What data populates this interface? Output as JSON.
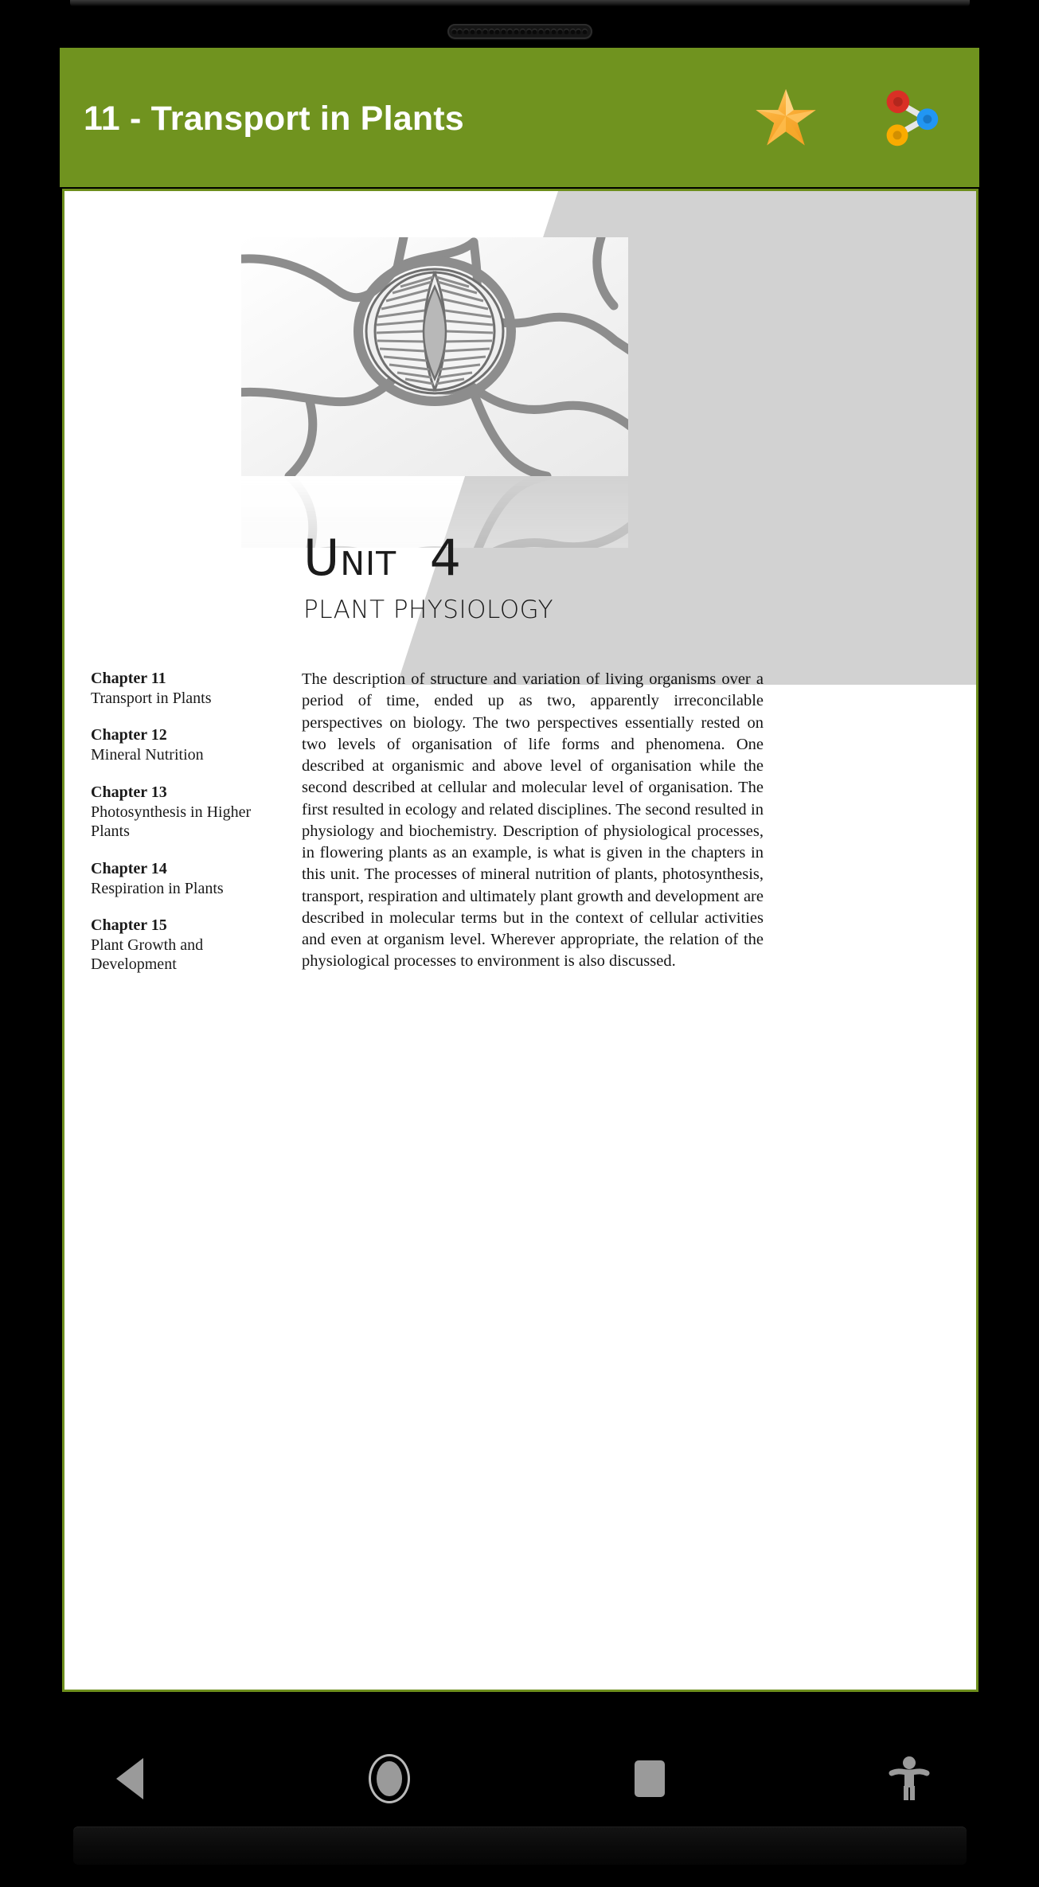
{
  "device": {
    "speaker_grille_holes": 22
  },
  "app": {
    "header": {
      "title": "11 - Transport in Plants",
      "background_color": "#70931f",
      "title_color": "#ffffff",
      "actions": [
        {
          "name": "bookmark-star",
          "icon": "star-icon",
          "colors": [
            "#f5a623",
            "#ffc85c",
            "#e8931a"
          ]
        },
        {
          "name": "share",
          "icon": "share-icon",
          "colors": [
            "#d93025",
            "#2196f3",
            "#f9ab00"
          ]
        }
      ]
    },
    "page": {
      "border_color": "#6e8f1d",
      "background_color": "#ffffff",
      "gray_panel_color": "#d2d2d2",
      "figure": {
        "name": "stomata-diagram",
        "caption": "",
        "description": "Grayscale micrograph-style illustration of a stoma with guard cells surrounded by epidermal cells"
      },
      "unit": {
        "title_lead": "U",
        "title_rest": "NIT",
        "title_number": "4",
        "subtitle": "PLANT PHYSIOLOGY"
      },
      "chapters": [
        {
          "number": "Chapter 11",
          "name": "Transport in Plants"
        },
        {
          "number": "Chapter 12",
          "name": "Mineral Nutrition"
        },
        {
          "number": "Chapter 13",
          "name": "Photosynthesis in Higher Plants"
        },
        {
          "number": "Chapter 14",
          "name": "Respiration in Plants"
        },
        {
          "number": "Chapter 15",
          "name": "Plant Growth and Development"
        }
      ],
      "intro_text": "The description of structure and variation of living organisms over a period of time, ended up as two, apparently irreconcilable perspectives on biology. The two perspectives essentially rested on two levels of organisation of life forms and phenomena. One described at organismic and above level of organisation while the second described at cellular and molecular level of organisation. The first resulted in ecology and related disciplines. The second resulted in physiology and biochemistry. Description of physiological processes, in flowering plants as an example, is what is given in the chapters in this unit. The processes of mineral nutrition of plants, photosynthesis, transport, respiration and ultimately plant growth and development are described in molecular terms but in the context of cellular activities and even at organism level. Wherever appropriate, the relation of the physiological processes to environment is also discussed."
    }
  },
  "navbar": {
    "buttons": [
      {
        "name": "back",
        "icon": "back-triangle-icon",
        "label": "Back"
      },
      {
        "name": "home",
        "icon": "home-circle-icon",
        "label": "Home"
      },
      {
        "name": "recents",
        "icon": "recents-square-icon",
        "label": "Recents"
      },
      {
        "name": "accessibility",
        "icon": "accessibility-icon",
        "label": "Accessibility"
      }
    ],
    "icon_color": "#9a9a9a"
  }
}
